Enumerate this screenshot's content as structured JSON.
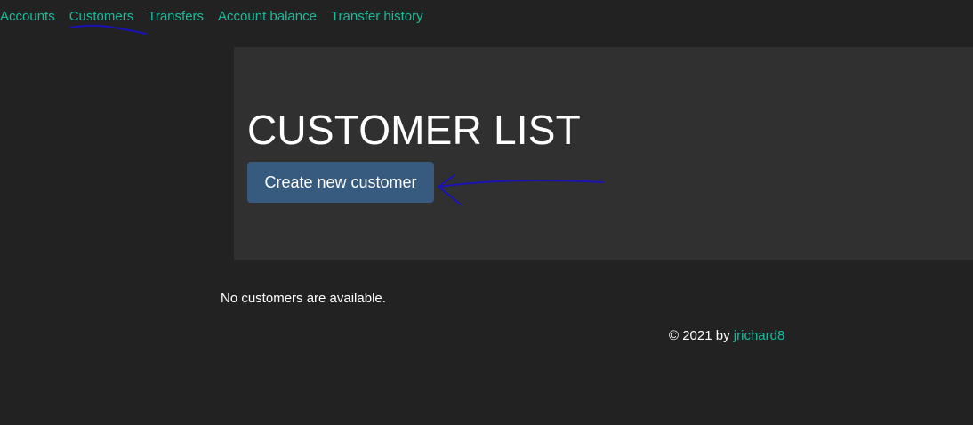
{
  "colors": {
    "background": "#222222",
    "jumbotron": "#303030",
    "link": "#18bc9c",
    "button": "#375a7f",
    "text": "#ffffff",
    "annotation_ink": "#1a12b5"
  },
  "nav": {
    "items": [
      {
        "label": "Accounts"
      },
      {
        "label": "Customers"
      },
      {
        "label": "Transfers"
      },
      {
        "label": "Account balance"
      },
      {
        "label": "Transfer history"
      }
    ]
  },
  "main": {
    "title": "CUSTOMER LIST",
    "create_button_label": "Create new customer",
    "empty_message": "No customers are available."
  },
  "footer": {
    "copyright": "© 2021 by ",
    "author": "jrichard8"
  }
}
